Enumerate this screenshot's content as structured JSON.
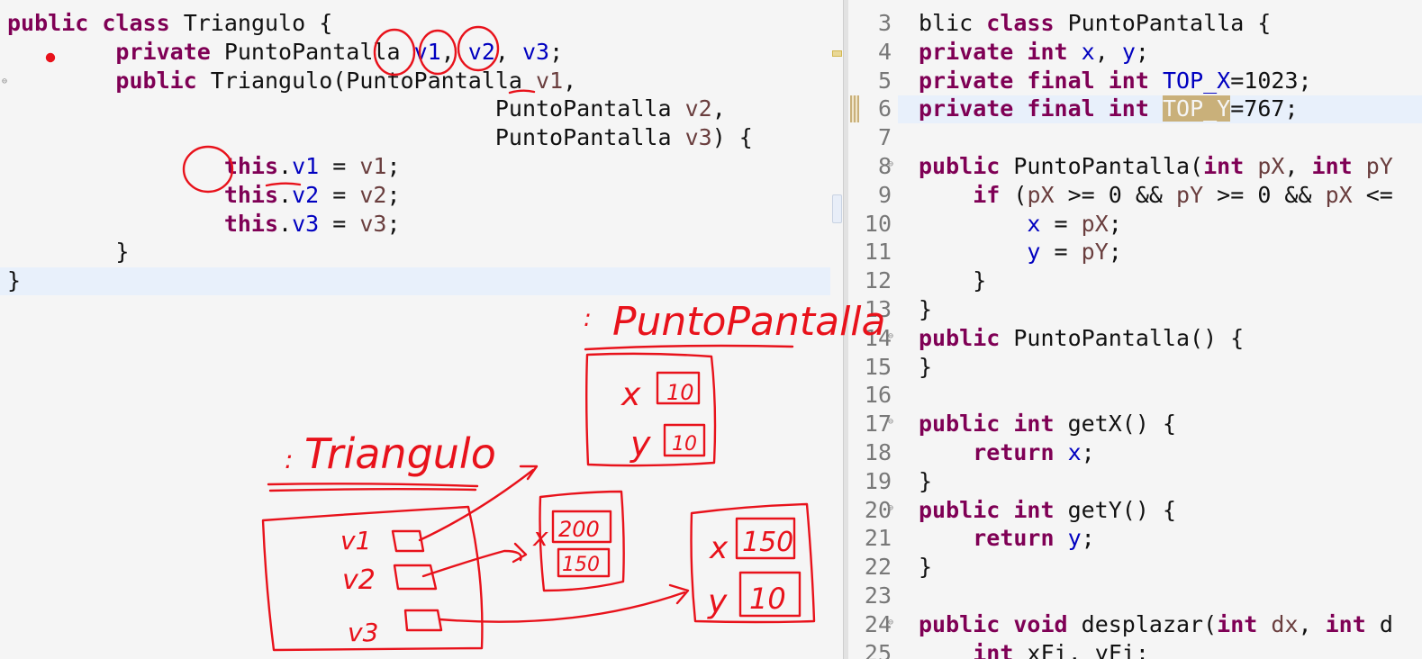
{
  "left_editor": {
    "lines": [
      [
        {
          "t": "public",
          "c": "kw"
        },
        {
          "t": " "
        },
        {
          "t": "class",
          "c": "kw"
        },
        {
          "t": " Triangulo {"
        }
      ],
      [
        {
          "t": "        "
        },
        {
          "t": "private",
          "c": "kw"
        },
        {
          "t": " PuntoPantalla "
        },
        {
          "t": "v1",
          "c": "fld"
        },
        {
          "t": ", "
        },
        {
          "t": "v2",
          "c": "fld"
        },
        {
          "t": ", "
        },
        {
          "t": "v3",
          "c": "fld"
        },
        {
          "t": ";"
        }
      ],
      [
        {
          "t": "        "
        },
        {
          "t": "public",
          "c": "kw"
        },
        {
          "t": " Triangulo(PuntoPantalla "
        },
        {
          "t": "v1",
          "c": "par"
        },
        {
          "t": ","
        }
      ],
      [
        {
          "t": "                                    PuntoPantalla "
        },
        {
          "t": "v2",
          "c": "par"
        },
        {
          "t": ","
        }
      ],
      [
        {
          "t": "                                    PuntoPantalla "
        },
        {
          "t": "v3",
          "c": "par"
        },
        {
          "t": ") {"
        }
      ],
      [
        {
          "t": "                "
        },
        {
          "t": "this",
          "c": "kw"
        },
        {
          "t": "."
        },
        {
          "t": "v1",
          "c": "fld"
        },
        {
          "t": " = "
        },
        {
          "t": "v1",
          "c": "par"
        },
        {
          "t": ";"
        }
      ],
      [
        {
          "t": "                "
        },
        {
          "t": "this",
          "c": "kw"
        },
        {
          "t": "."
        },
        {
          "t": "v2",
          "c": "fld"
        },
        {
          "t": " = "
        },
        {
          "t": "v2",
          "c": "par"
        },
        {
          "t": ";"
        }
      ],
      [
        {
          "t": "                "
        },
        {
          "t": "this",
          "c": "kw"
        },
        {
          "t": "."
        },
        {
          "t": "v3",
          "c": "fld"
        },
        {
          "t": " = "
        },
        {
          "t": "v3",
          "c": "par"
        },
        {
          "t": ";"
        }
      ],
      [
        {
          "t": "        }"
        }
      ],
      [
        {
          "t": "}"
        }
      ]
    ]
  },
  "right_editor": {
    "line_numbers": [
      "3",
      "4",
      "5",
      "6",
      "7",
      "8",
      "9",
      "10",
      "11",
      "12",
      "13",
      "14",
      "15",
      "16",
      "17",
      "18",
      "19",
      "20",
      "21",
      "22",
      "23",
      "24",
      "25"
    ],
    "fold_markers_at": [
      "8",
      "14",
      "17",
      "20",
      "24"
    ],
    "lines": [
      [
        {
          "t": "blic "
        },
        {
          "t": "class",
          "c": "kw"
        },
        {
          "t": " PuntoPantalla {"
        }
      ],
      [
        {
          "t": "private",
          "c": "kw"
        },
        {
          "t": " "
        },
        {
          "t": "int",
          "c": "kw"
        },
        {
          "t": " "
        },
        {
          "t": "x",
          "c": "fld"
        },
        {
          "t": ", "
        },
        {
          "t": "y",
          "c": "fld"
        },
        {
          "t": ";"
        }
      ],
      [
        {
          "t": "private",
          "c": "kw"
        },
        {
          "t": " "
        },
        {
          "t": "final",
          "c": "kw"
        },
        {
          "t": " "
        },
        {
          "t": "int",
          "c": "kw"
        },
        {
          "t": " "
        },
        {
          "t": "TOP_X",
          "c": "fld"
        },
        {
          "t": "=1023;"
        }
      ],
      [
        {
          "t": "private",
          "c": "kw"
        },
        {
          "t": " "
        },
        {
          "t": "final",
          "c": "kw"
        },
        {
          "t": " "
        },
        {
          "t": "int",
          "c": "kw"
        },
        {
          "t": " "
        },
        {
          "t": "TOP_Y",
          "c": "hl"
        },
        {
          "t": "=767;"
        }
      ],
      [
        {
          "t": ""
        }
      ],
      [
        {
          "t": "public",
          "c": "kw"
        },
        {
          "t": " PuntoPantalla("
        },
        {
          "t": "int",
          "c": "kw"
        },
        {
          "t": " "
        },
        {
          "t": "pX",
          "c": "par"
        },
        {
          "t": ", "
        },
        {
          "t": "int",
          "c": "kw"
        },
        {
          "t": " "
        },
        {
          "t": "pY",
          "c": "par"
        }
      ],
      [
        {
          "t": "    "
        },
        {
          "t": "if",
          "c": "kw"
        },
        {
          "t": " ("
        },
        {
          "t": "pX",
          "c": "par"
        },
        {
          "t": " >= 0 && "
        },
        {
          "t": "pY",
          "c": "par"
        },
        {
          "t": " >= 0 && "
        },
        {
          "t": "pX",
          "c": "par"
        },
        {
          "t": " <="
        }
      ],
      [
        {
          "t": "        "
        },
        {
          "t": "x",
          "c": "fld"
        },
        {
          "t": " = "
        },
        {
          "t": "pX",
          "c": "par"
        },
        {
          "t": ";"
        }
      ],
      [
        {
          "t": "        "
        },
        {
          "t": "y",
          "c": "fld"
        },
        {
          "t": " = "
        },
        {
          "t": "pY",
          "c": "par"
        },
        {
          "t": ";"
        }
      ],
      [
        {
          "t": "    }"
        }
      ],
      [
        {
          "t": "}"
        }
      ],
      [
        {
          "t": "public",
          "c": "kw"
        },
        {
          "t": " PuntoPantalla() {"
        }
      ],
      [
        {
          "t": "}"
        }
      ],
      [
        {
          "t": ""
        }
      ],
      [
        {
          "t": "public",
          "c": "kw"
        },
        {
          "t": " "
        },
        {
          "t": "int",
          "c": "kw"
        },
        {
          "t": " getX() {"
        }
      ],
      [
        {
          "t": "    "
        },
        {
          "t": "return",
          "c": "kw"
        },
        {
          "t": " "
        },
        {
          "t": "x",
          "c": "fld"
        },
        {
          "t": ";"
        }
      ],
      [
        {
          "t": "}"
        }
      ],
      [
        {
          "t": "public",
          "c": "kw"
        },
        {
          "t": " "
        },
        {
          "t": "int",
          "c": "kw"
        },
        {
          "t": " getY() {"
        }
      ],
      [
        {
          "t": "    "
        },
        {
          "t": "return",
          "c": "kw"
        },
        {
          "t": " "
        },
        {
          "t": "y",
          "c": "fld"
        },
        {
          "t": ";"
        }
      ],
      [
        {
          "t": "}"
        }
      ],
      [
        {
          "t": ""
        }
      ],
      [
        {
          "t": "public",
          "c": "kw"
        },
        {
          "t": " "
        },
        {
          "t": "void",
          "c": "kw"
        },
        {
          "t": " desplazar("
        },
        {
          "t": "int",
          "c": "kw"
        },
        {
          "t": " "
        },
        {
          "t": "dx",
          "c": "par"
        },
        {
          "t": ", "
        },
        {
          "t": "int",
          "c": "kw"
        },
        {
          "t": " d"
        }
      ],
      [
        {
          "t": "    "
        },
        {
          "t": "int",
          "c": "kw"
        },
        {
          "t": " xFi, yFi;"
        }
      ]
    ]
  },
  "annotations": {
    "color": "#e8121b",
    "labels": {
      "class_point": "PuntoPantalla",
      "class_triangle": "Triangulo",
      "instance_marker": ":",
      "point_x": "x",
      "point_y": "y",
      "tri_v1": "v1",
      "tri_v2": "v2",
      "tri_v3": "v3",
      "p1_x_val": "10",
      "p1_y_val": "10",
      "p2_x_val": "200",
      "p2_y_val": "150",
      "p3_x_val": "150",
      "p3_y_val": "10"
    }
  },
  "colors": {
    "keyword": "#7f0055",
    "field": "#0000c0",
    "parameter": "#6a3e3e",
    "occurrence_highlight": "#c9b07a",
    "current_line": "#e8f0fb",
    "ink": "#e8121b"
  }
}
